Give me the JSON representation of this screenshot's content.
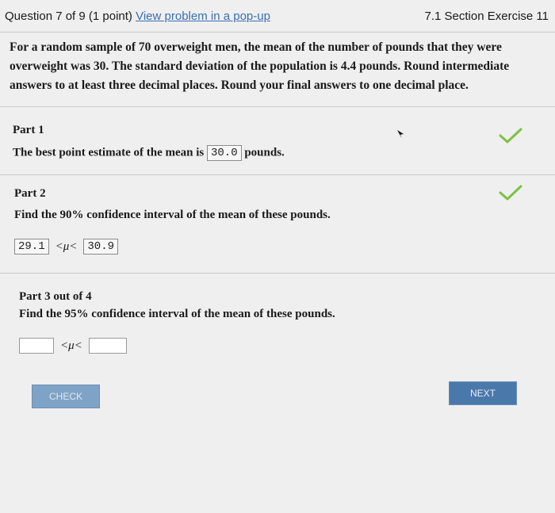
{
  "header": {
    "question": "Question 7 of 9 (1 point)",
    "popup_link": "View problem in a pop-up",
    "section": "7.1 Section Exercise 11"
  },
  "intro": "For a random sample of 70 overweight men, the mean of the number of pounds that they were overweight was 30. The standard deviation of the population is 4.4 pounds. Round intermediate answers to at least three decimal places. Round your final answers to one decimal place.",
  "part1": {
    "title": "Part 1",
    "prefix": "The best point estimate of the mean is",
    "value": "30.0",
    "suffix": "pounds."
  },
  "part2": {
    "title": "Part 2",
    "prompt": "Find the 90% confidence interval of the mean of these pounds.",
    "lower": "29.1",
    "upper": "30.9",
    "relation": "<μ<"
  },
  "part3": {
    "title": "Part 3 out of 4",
    "prompt": "Find the 95% confidence interval of the mean of these pounds.",
    "lower": "",
    "upper": "",
    "relation": "<μ<"
  },
  "buttons": {
    "check": "CHECK",
    "next": "NEXT"
  },
  "colors": {
    "checkmark": "#7dc242",
    "link": "#3a6fb0",
    "next_button": "#4a78aa"
  },
  "icons": {
    "part1_status": "checkmark-icon",
    "part2_status": "checkmark-icon",
    "pointer": "mouse-cursor-icon"
  }
}
